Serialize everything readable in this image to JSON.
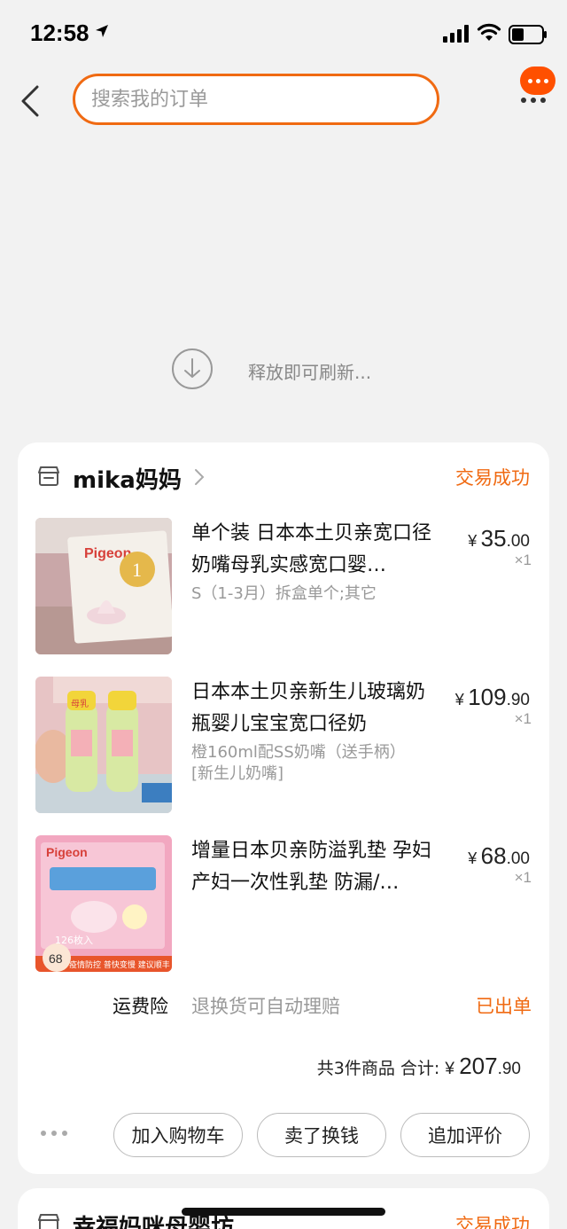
{
  "status_bar": {
    "time": "12:58"
  },
  "search": {
    "placeholder": "搜索我的订单"
  },
  "refresh": {
    "text": "释放即可刷新..."
  },
  "order": {
    "shop_name": "mika妈妈",
    "status": "交易成功",
    "items": [
      {
        "title": "单个装 日本本土贝亲宽口径奶嘴母乳实感宽口婴…",
        "spec": "S（1-3月）拆盒单个;其它",
        "price_yen": "¥",
        "price_int": "35",
        "price_dec": ".00",
        "qty": "×1",
        "thumb_colors": {
          "bg": "#c9a7a8",
          "box": "#f4f0ea",
          "accent": "#e5b84b"
        },
        "thumb_text": "Pigeon"
      },
      {
        "title": "日本本土贝亲新生儿玻璃奶瓶婴儿宝宝宽口径奶",
        "spec": "橙160ml配SS奶嘴（送手柄）[新生儿奶嘴]",
        "price_yen": "¥",
        "price_int": "109",
        "price_dec": ".90",
        "qty": "×1",
        "thumb_colors": {
          "bg": "#e7c4c5",
          "bottle": "#d8e9a3",
          "cap": "#f2d53a"
        },
        "thumb_text": "母乳"
      },
      {
        "title": "增量日本贝亲防溢乳垫 孕妇产妇一次性乳垫 防漏/…",
        "spec": "",
        "price_yen": "¥",
        "price_int": "68",
        "price_dec": ".00",
        "qty": "×1",
        "thumb_colors": {
          "bg": "#f2a7c0",
          "banner": "#e8552b"
        },
        "thumb_text": "Pigeon",
        "thumb_badge": "68",
        "thumb_banner": "疫情防控 普快变慢 建议顺丰",
        "thumb_count": "126枚入"
      }
    ],
    "insurance": {
      "label": "运费险",
      "desc": "退换货可自动理赔",
      "status": "已出单"
    },
    "total": {
      "prefix": "共3件商品 合计:",
      "yen": "¥",
      "int": "207",
      "dec": ".90"
    },
    "actions": [
      "加入购物车",
      "卖了换钱",
      "追加评价"
    ]
  },
  "next_order": {
    "shop_name": "幸福妈咪母婴坊",
    "status": "交易成功"
  },
  "colors": {
    "accent": "#f06a12",
    "badge": "#ff5000",
    "background": "#f2f2f2"
  }
}
